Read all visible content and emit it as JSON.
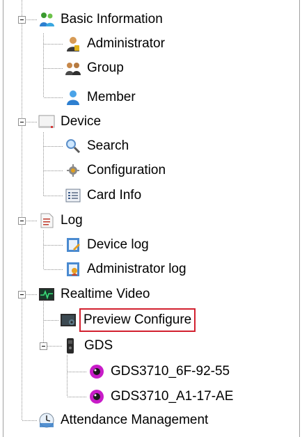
{
  "tree": {
    "basic_information": {
      "label": "Basic Information",
      "icon": "group-people-icon",
      "children": [
        {
          "label": "Administrator",
          "icon": "administrator-icon"
        },
        {
          "label": "Group",
          "icon": "group-icon"
        },
        {
          "label": "Member",
          "icon": "member-icon"
        }
      ]
    },
    "device": {
      "label": "Device",
      "icon": "device-icon",
      "children": [
        {
          "label": "Search",
          "icon": "search-icon"
        },
        {
          "label": "Configuration",
          "icon": "gear-icon"
        },
        {
          "label": "Card Info",
          "icon": "card-info-icon"
        }
      ]
    },
    "log": {
      "label": "Log",
      "icon": "log-icon",
      "children": [
        {
          "label": "Device log",
          "icon": "device-log-icon"
        },
        {
          "label": "Administrator log",
          "icon": "administrator-log-icon"
        }
      ]
    },
    "realtime_video": {
      "label": "Realtime Video",
      "icon": "realtime-video-icon",
      "children": [
        {
          "label": "Preview Configure",
          "icon": "preview-configure-icon",
          "selected": true
        },
        {
          "label": "GDS",
          "icon": "gds-device-icon",
          "children": [
            {
              "label": "GDS3710_6F-92-55",
              "icon": "camera-icon"
            },
            {
              "label": "GDS3710_A1-17-AE",
              "icon": "camera-icon"
            }
          ]
        }
      ]
    },
    "attendance_management": {
      "label": "Attendance Management",
      "icon": "attendance-icon"
    }
  },
  "colors": {
    "selection_border": "#d2202f",
    "tree_line": "#909090",
    "panel_border": "#a0a0a0",
    "camera_lens": "#c81cc8"
  }
}
